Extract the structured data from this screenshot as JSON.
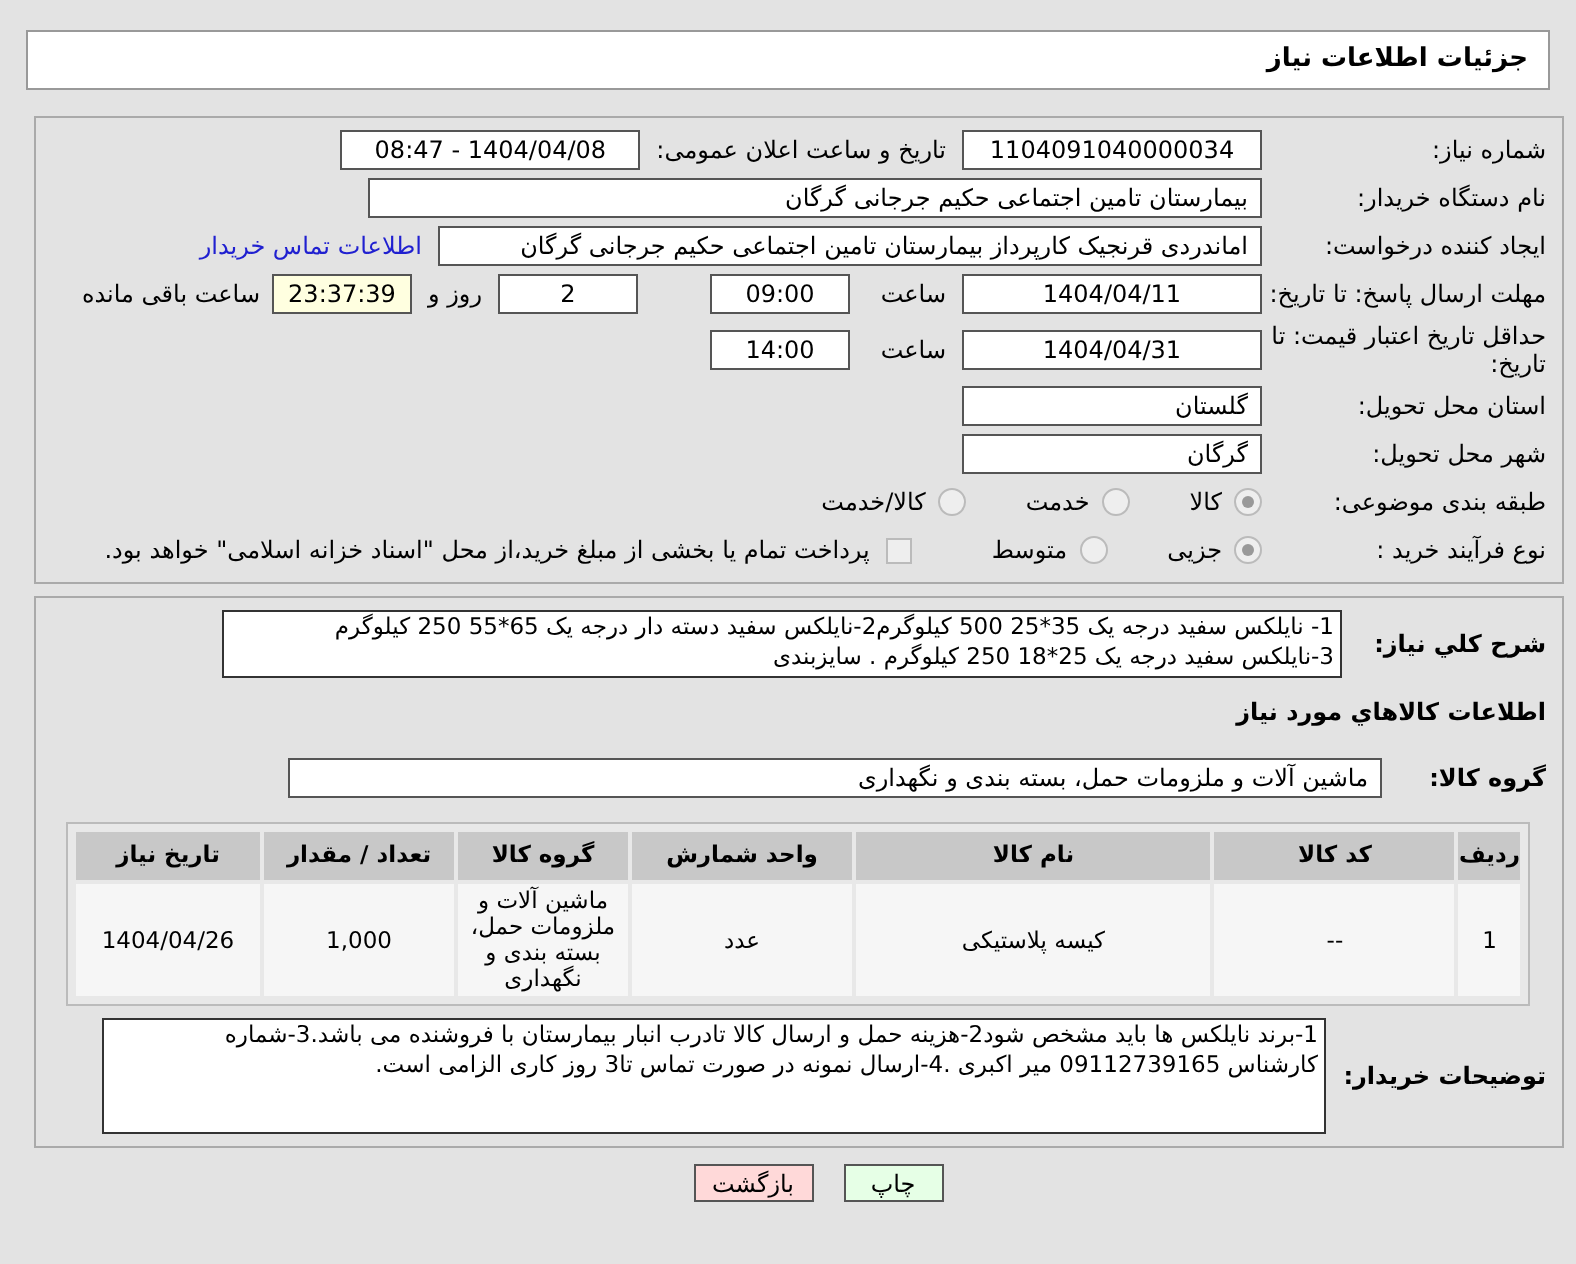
{
  "header": {
    "title": "جزئیات اطلاعات نیاز"
  },
  "need_number": {
    "label": "شماره نیاز:",
    "value": "1104091040000034"
  },
  "announce": {
    "label": "تاریخ و ساعت اعلان عمومی:",
    "value": "1404/04/08 - 08:47"
  },
  "buyer_org": {
    "label": "نام دستگاه خریدار:",
    "value": "بیمارستان تامین اجتماعی حکیم جرجانی گرگان"
  },
  "requester": {
    "label": "ایجاد کننده درخواست:",
    "value": "اماندردی قرنجیک کارپرداز بیمارستان تامین اجتماعی حکیم جرجانی گرگان",
    "link": "اطلاعات تماس خریدار"
  },
  "response_deadline": {
    "label": "مهلت ارسال پاسخ: تا تاریخ:",
    "date": "1404/04/11",
    "time_label": "ساعت",
    "time": "09:00",
    "days": "2",
    "days_label": "روز و",
    "remaining": "23:37:39",
    "remaining_label": "ساعت باقی مانده"
  },
  "price_validity": {
    "label": "حداقل تاریخ اعتبار قیمت: تا تاریخ:",
    "date": "1404/04/31",
    "time_label": "ساعت",
    "time": "14:00"
  },
  "province": {
    "label": "استان محل تحویل:",
    "value": "گلستان"
  },
  "city": {
    "label": "شهر محل تحویل:",
    "value": "گرگان"
  },
  "category": {
    "label": "طبقه بندی موضوعی:",
    "options": [
      {
        "label": "کالا",
        "selected": true
      },
      {
        "label": "خدمت",
        "selected": false
      },
      {
        "label": "کالا/خدمت",
        "selected": false
      }
    ]
  },
  "process": {
    "label": "نوع فرآیند خرید :",
    "options": [
      {
        "label": "جزیی",
        "selected": true
      },
      {
        "label": "متوسط",
        "selected": false
      }
    ],
    "payment_note": {
      "label": "پرداخت تمام یا بخشی از مبلغ خرید،از محل \"اسناد خزانه اسلامی\" خواهد بود.",
      "checked": false
    }
  },
  "description": {
    "label": "شرح کلي نياز:",
    "lines": [
      "1- نایلکس سفید درجه یک 35*25     500 کیلوگرم2-نایلکس سفید دسته دار درجه یک 65*55    250 کیلوگرم",
      "3-نایلکس سفید درجه یک 25*18     250 کیلوگرم . سایزبندی"
    ]
  },
  "goods_title": "اطلاعات کالاهاي مورد نياز",
  "goods_group": {
    "label": "گروه کالا:",
    "value": "ماشین آلات و ملزومات حمل، بسته بندی و نگهداری"
  },
  "table": {
    "columns": [
      "ردیف",
      "کد کالا",
      "نام کالا",
      "واحد شمارش",
      "گروه کالا",
      "تعداد / مقدار",
      "تاریخ نیاز"
    ],
    "rows": [
      [
        "1",
        "--",
        "کیسه پلاستیکی",
        "عدد",
        "ماشین آلات و ملزومات حمل، بسته بندی و نگهداری",
        "1,000",
        "1404/04/26"
      ]
    ]
  },
  "buyer_notes": {
    "label": "توضیحات خریدار:",
    "lines": [
      "1-برند نایلکس ها باید مشخص شود2-هزینه حمل و ارسال کالا تادرب انبار بیمارستان با فروشنده می باشد.3-شماره",
      "کارشناس 09112739165 میر اکبری .4-ارسال نمونه در صورت تماس تا3 روز کاری الزامی است."
    ]
  },
  "buttons": [
    {
      "label": "چاپ",
      "kind": "print"
    },
    {
      "label": "بازگشت",
      "kind": "back"
    }
  ]
}
